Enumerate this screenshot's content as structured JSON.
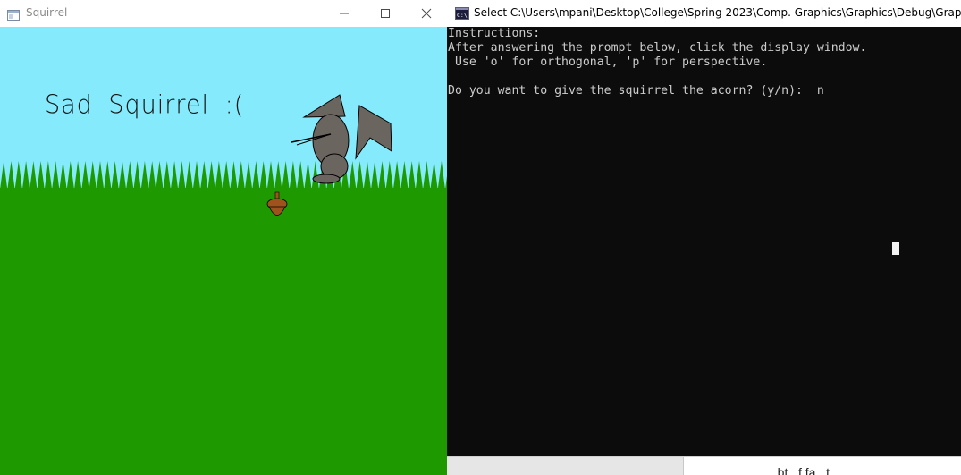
{
  "squirrel_window": {
    "title": "Squirrel",
    "scene_text": "Sad Squirrel :(",
    "colors": {
      "sky": "#84eafc",
      "grass": "#1e9a00",
      "squirrel": "#6b6560",
      "acorn": "#a0521d"
    }
  },
  "console_window": {
    "title": "Select C:\\Users\\mpani\\Desktop\\College\\Spring 2023\\Comp. Graphics\\Graphics\\Debug\\Graphics.exe",
    "lines": [
      "Instructions:",
      "After answering the prompt below, click the display window.",
      " Use 'o' for orthogonal, 'p' for perspective.",
      "",
      "Do you want to give the squirrel the acorn? (y/n):  n"
    ],
    "colors": {
      "background": "#0c0c0c",
      "text": "#cccccc"
    }
  },
  "background_window": {
    "partial_text": "...bt...f fa...t..."
  }
}
